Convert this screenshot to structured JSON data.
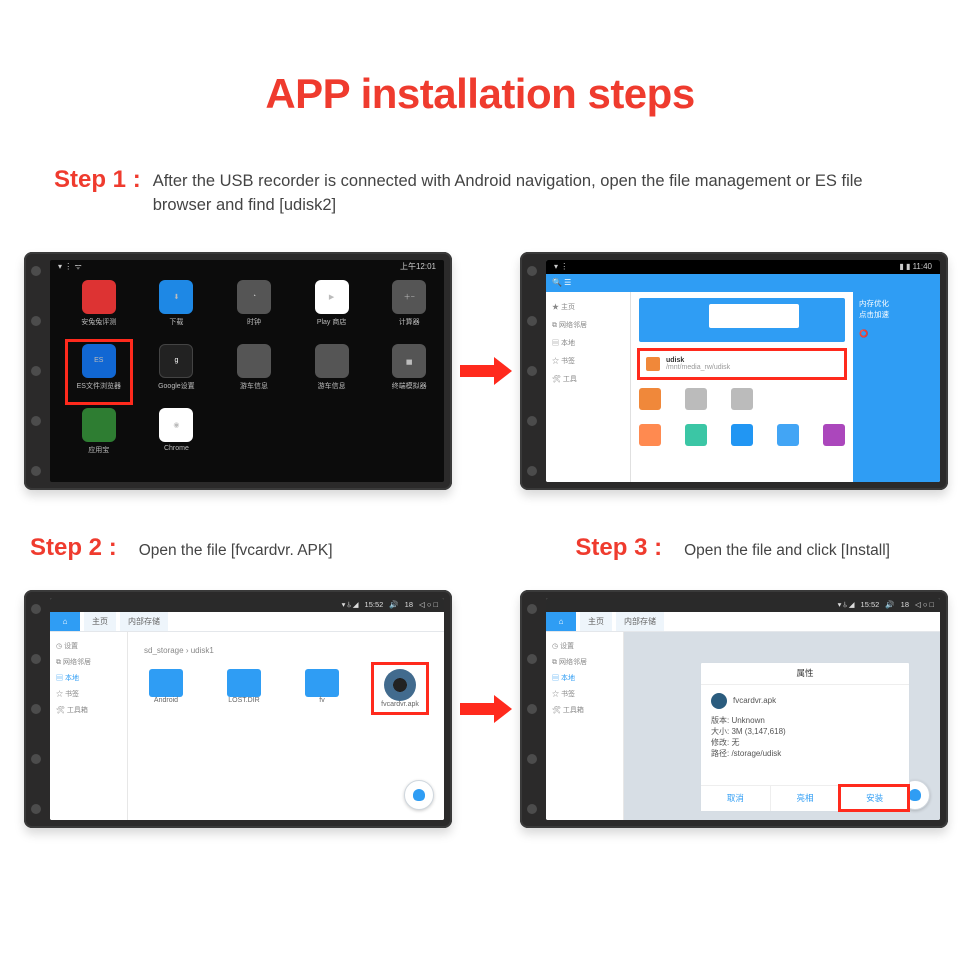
{
  "title": "APP installation steps",
  "step1": {
    "label": "Step 1 :",
    "text": "After the USB recorder is connected with Android navigation, open the file management or ES file browser and find [udisk2]"
  },
  "step2": {
    "label": "Step 2 :",
    "text": "Open the file [fvcardvr. APK]"
  },
  "step3": {
    "label": "Step 3 :",
    "text": "Open the file and click [Install]"
  },
  "screenA": {
    "time": "上午12:01",
    "apps": [
      {
        "name": "安兔兔评测"
      },
      {
        "name": "下载"
      },
      {
        "name": "时钟"
      },
      {
        "name": "Play 商店"
      },
      {
        "name": "计算器"
      },
      {
        "name": "ES文件浏览器"
      },
      {
        "name": "Google设置"
      },
      {
        "name": "游车信息"
      },
      {
        "name": "游车信息"
      },
      {
        "name": "终端模拟器"
      },
      {
        "name": "应用宝"
      },
      {
        "name": "Chrome"
      }
    ]
  },
  "screenB": {
    "sidebar": [
      "主页",
      "网络邻居",
      "本地",
      "书签",
      "工具"
    ],
    "udisk": "udisk",
    "udisk_sub": "/mnt/media_rw/udisk"
  },
  "screenC": {
    "status_time": "15:52",
    "status_vol": "18",
    "tabs": [
      "主页",
      "内部存储"
    ],
    "sidebar": [
      "设置",
      "网络邻居",
      "本地",
      "书签",
      "工具箱"
    ],
    "crumb": [
      "sd_storage",
      "udisk1"
    ],
    "files": [
      {
        "name": "Android",
        "type": "folder"
      },
      {
        "name": "LOST.DIR",
        "type": "folder"
      },
      {
        "name": "fv",
        "type": "folder"
      },
      {
        "name": "fvcardvr.apk",
        "type": "apk"
      }
    ]
  },
  "screenD": {
    "dialog_title": "属性",
    "app_name": "fvcardvr.apk",
    "lines": [
      "版本: Unknown",
      "大小: 3M (3,147,618)",
      "修改: 无",
      "路径: /storage/udisk"
    ],
    "buttons": [
      "取消",
      "亮相",
      "安装"
    ]
  }
}
